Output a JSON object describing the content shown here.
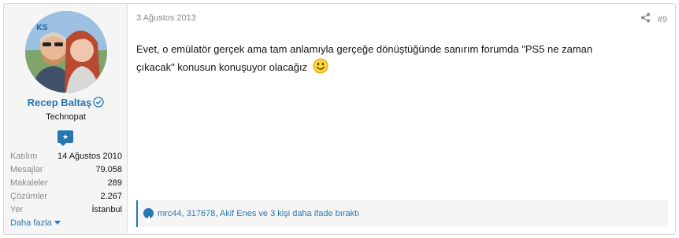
{
  "author": {
    "avatar_initials": "KS",
    "name": "Recep Baltaş",
    "title": "Technopat",
    "stats": [
      {
        "label": "Katılım",
        "value": "14 Ağustos 2010"
      },
      {
        "label": "Mesajlar",
        "value": "79.058"
      },
      {
        "label": "Makaleler",
        "value": "289"
      },
      {
        "label": "Çözümler",
        "value": "2.267"
      },
      {
        "label": "Yer",
        "value": "İstanbul"
      }
    ],
    "more_label": "Daha fazla"
  },
  "post": {
    "date": "3 Ağustos 2013",
    "number": "#9",
    "message_line1": "Evet, o emülatör gerçek ama tam anlamıyla gerçeğe dönüştüğünde sanırım forumda \"PS5 ne zaman",
    "message_line2": "çıkacak\" konusun konuşuyor olacağız",
    "smiley_icon": "smile-emoji-icon"
  },
  "reactions": {
    "text": "mrc44, 317678, Akif Enes ve 3 kişi daha ifade bıraktı",
    "icon": "like-icon"
  },
  "colors": {
    "accent": "#2577b1",
    "sidebar_bg": "#f5f5f5",
    "muted_text": "#8a8a8a"
  }
}
